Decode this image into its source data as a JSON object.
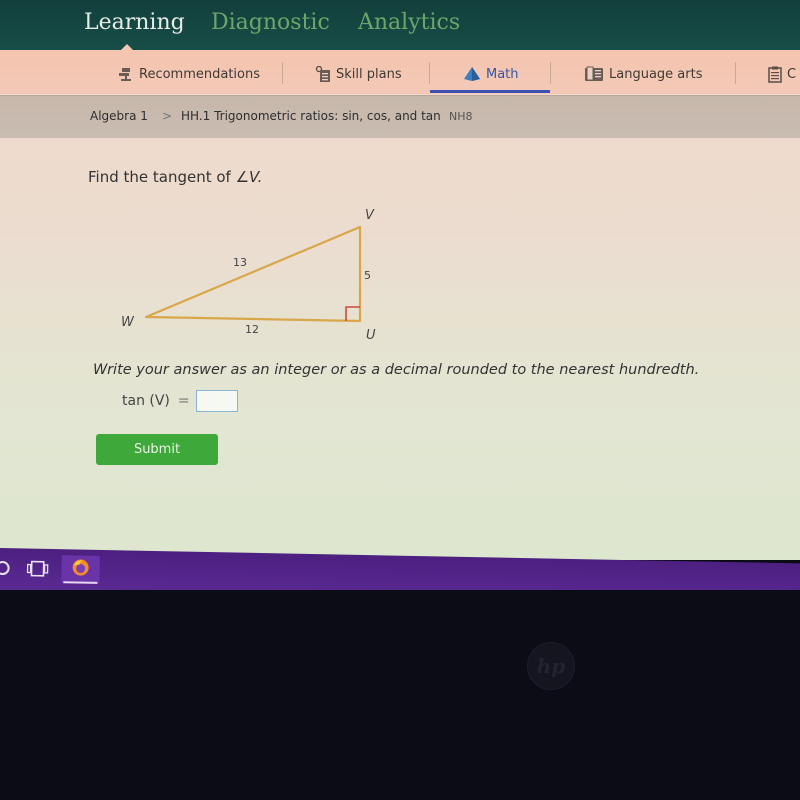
{
  "topnav": {
    "tabs": [
      {
        "label": "Learning",
        "active": true
      },
      {
        "label": "Diagnostic",
        "active": false
      },
      {
        "label": "Analytics",
        "active": false
      }
    ]
  },
  "subnav": {
    "items": [
      {
        "label": "Recommendations",
        "icon": "recommendations-icon",
        "active": false
      },
      {
        "label": "Skill plans",
        "icon": "skill-plans-icon",
        "active": false
      },
      {
        "label": "Math",
        "icon": "pyramid-icon",
        "active": true
      },
      {
        "label": "Language arts",
        "icon": "book-icon",
        "active": false
      },
      {
        "label": "C",
        "icon": "clipboard-icon",
        "active": false
      }
    ]
  },
  "breadcrumb": {
    "subject": "Algebra 1",
    "separator": ">",
    "skill": "HH.1 Trigonometric ratios: sin, cos, and tan",
    "code": "NH8"
  },
  "question": {
    "prompt": "Find the tangent of ",
    "angle": "∠V.",
    "triangle": {
      "vertices": {
        "W": "W",
        "U": "U",
        "V": "V"
      },
      "sides": {
        "WV": "13",
        "UV": "5",
        "WU": "12"
      },
      "right_angle_at": "U",
      "colors": {
        "sides": "#d9a64a",
        "right_angle_marker": "#d0493f"
      }
    },
    "instructions": "Write your answer as an integer or as a decimal rounded to the nearest hundredth.",
    "answer_label": "tan (V)",
    "equals": "=",
    "answer_value": "",
    "submit_label": "Submit"
  },
  "taskbar": {
    "items": [
      "search-icon",
      "task-view-icon",
      "firefox-icon"
    ],
    "active": "firefox-icon"
  },
  "device": {
    "brand_logo": "hp"
  },
  "colors": {
    "topnav_bg": "#184d47",
    "subnav_bg": "#f3c7b3",
    "active_accent": "#3b50b0",
    "submit_green": "#3ea83a",
    "taskbar_purple": "#55268c"
  }
}
